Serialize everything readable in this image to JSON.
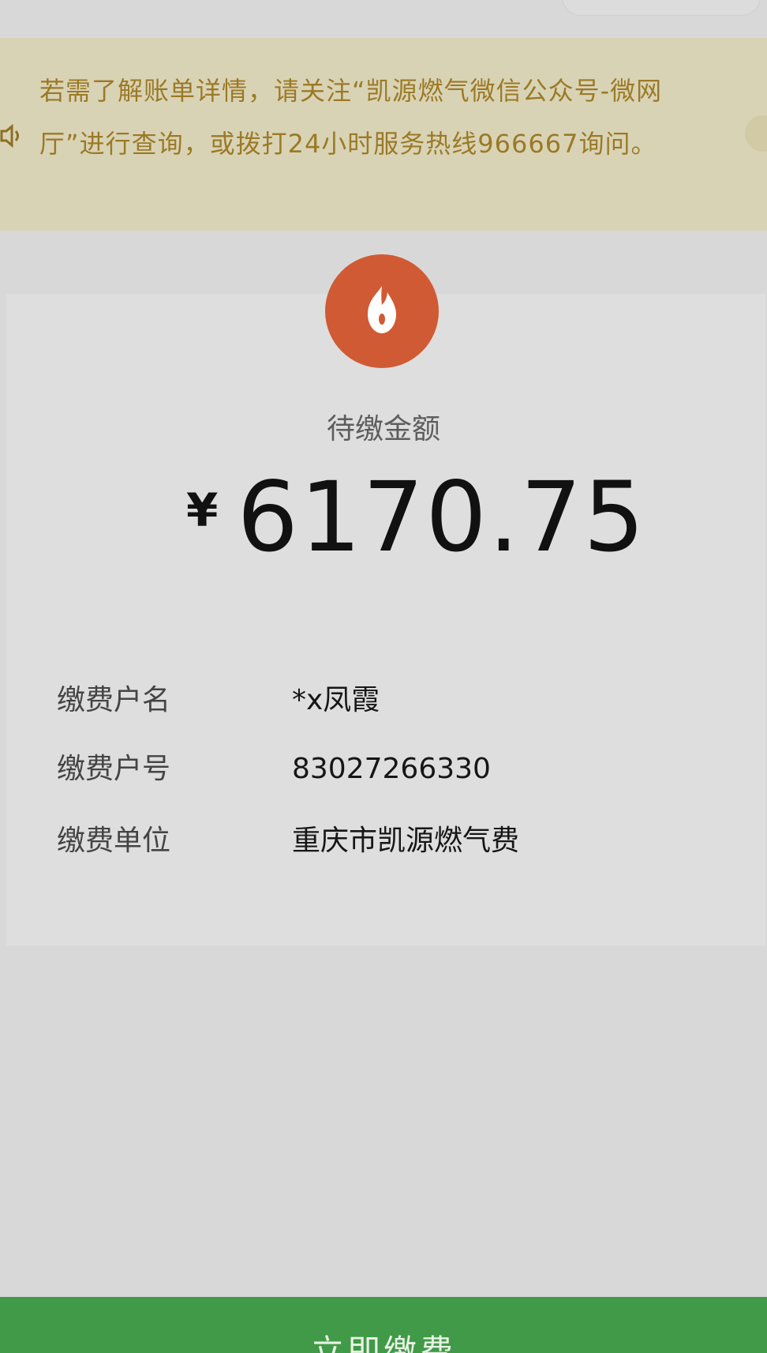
{
  "notice": {
    "text": "若需了解账单详情，请关注“凯源燃气微信公众号-微网厅”进行查询，或拨打24小时服务热线966667询问。"
  },
  "bill": {
    "amount_label": "待缴金额",
    "currency_symbol": "¥",
    "amount": "6170.75"
  },
  "details": [
    {
      "label": "缴费户名",
      "value": "*x凤霞"
    },
    {
      "label": "缴费户号",
      "value": "83027266330"
    },
    {
      "label": "缴费单位",
      "value": "重庆市凯源燃气费"
    }
  ],
  "actions": {
    "pay_label": "立即缴费"
  },
  "colors": {
    "notice_background": "#d9d3b6",
    "notice_text": "#9b7a25",
    "flame_badge": "#d05a33",
    "pay_button": "#419a47"
  },
  "icons": {
    "notice_speaker": "speaker-icon",
    "bill_badge": "flame-icon"
  }
}
